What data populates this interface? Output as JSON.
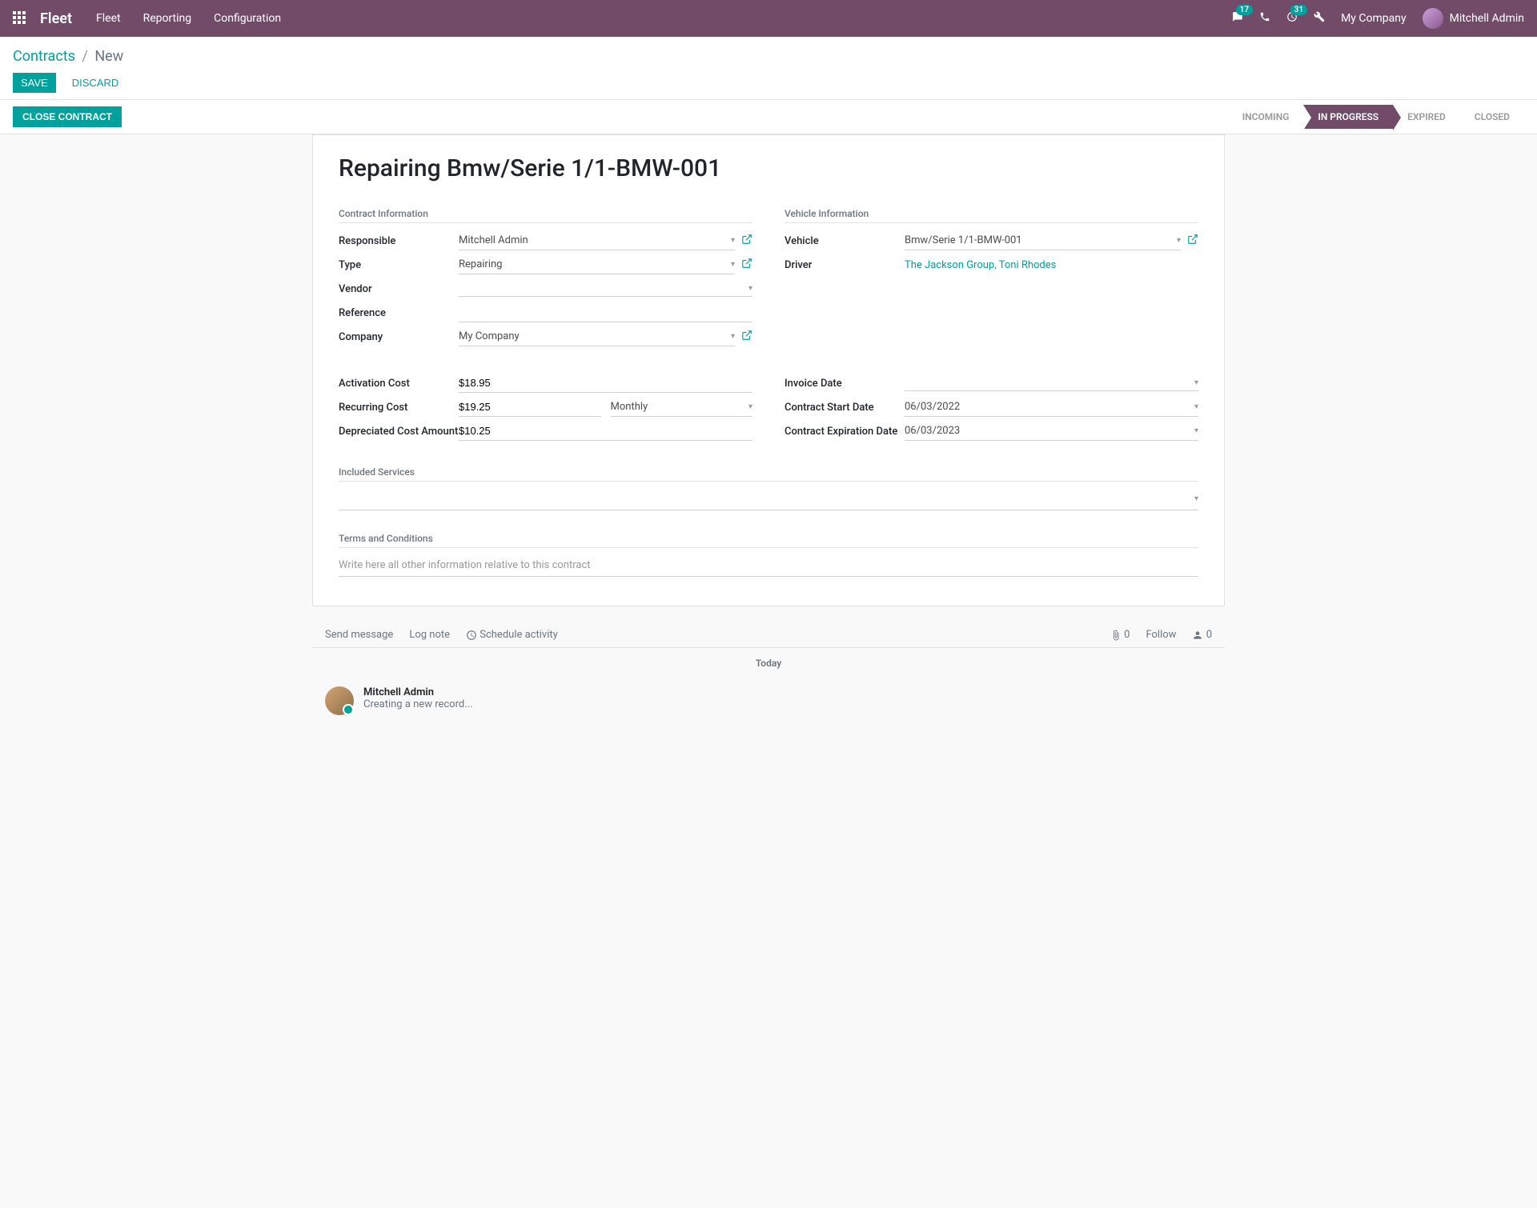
{
  "topbar": {
    "brand": "Fleet",
    "nav": [
      "Fleet",
      "Reporting",
      "Configuration"
    ],
    "chat_badge": "17",
    "activity_badge": "31",
    "company": "My Company",
    "user": "Mitchell Admin"
  },
  "breadcrumb": {
    "parent": "Contracts",
    "current": "New"
  },
  "buttons": {
    "save": "SAVE",
    "discard": "DISCARD",
    "close_contract": "CLOSE CONTRACT"
  },
  "status": {
    "steps": [
      "INCOMING",
      "IN PROGRESS",
      "EXPIRED",
      "CLOSED"
    ],
    "active_index": 1
  },
  "form": {
    "title": "Repairing Bmw/Serie 1/1-BMW-001",
    "sections": {
      "contract_info": "Contract Information",
      "vehicle_info": "Vehicle Information",
      "included_services": "Included Services",
      "terms": "Terms and Conditions"
    },
    "labels": {
      "responsible": "Responsible",
      "type": "Type",
      "vendor": "Vendor",
      "reference": "Reference",
      "company": "Company",
      "vehicle": "Vehicle",
      "driver": "Driver",
      "activation_cost": "Activation Cost",
      "recurring_cost": "Recurring Cost",
      "depreciated": "Depreciated Cost Amount",
      "invoice_date": "Invoice Date",
      "start_date": "Contract Start Date",
      "expiration_date": "Contract Expiration Date"
    },
    "values": {
      "responsible": "Mitchell Admin",
      "type": "Repairing",
      "vendor": "",
      "reference": "",
      "company": "My Company",
      "vehicle": "Bmw/Serie 1/1-BMW-001",
      "driver": "The Jackson Group, Toni Rhodes",
      "activation_cost": "$18.95",
      "recurring_cost": "$19.25",
      "recurring_period": "Monthly",
      "depreciated": "$10.25",
      "invoice_date": "",
      "start_date": "06/03/2022",
      "expiration_date": "06/03/2023"
    },
    "terms_placeholder": "Write here all other information relative to this contract"
  },
  "chatter": {
    "actions": {
      "send": "Send message",
      "log": "Log note",
      "schedule": "Schedule activity"
    },
    "attachments": "0",
    "follow": "Follow",
    "followers": "0",
    "date_header": "Today",
    "message": {
      "author": "Mitchell Admin",
      "body": "Creating a new record..."
    }
  }
}
